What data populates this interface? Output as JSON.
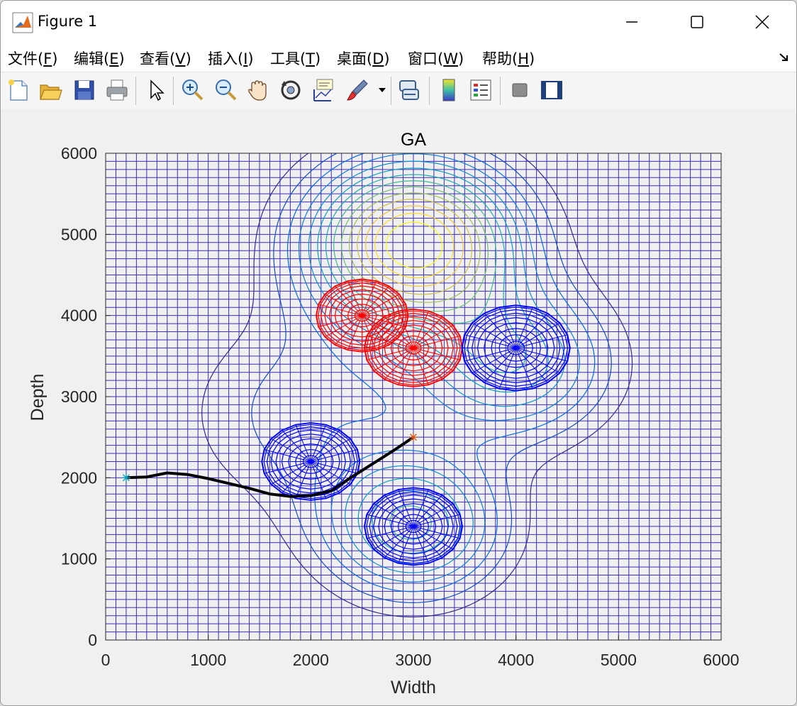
{
  "window": {
    "title": "Figure 1"
  },
  "menu": [
    {
      "label": "文件(",
      "key": "F",
      "end": ")"
    },
    {
      "label": "编辑(",
      "key": "E",
      "end": ")"
    },
    {
      "label": "查看(",
      "key": "V",
      "end": ")"
    },
    {
      "label": "插入(",
      "key": "I",
      "end": ")"
    },
    {
      "label": "工具(",
      "key": "T",
      "end": ")"
    },
    {
      "label": "桌面(",
      "key": "D",
      "end": ")"
    },
    {
      "label": "窗口(",
      "key": "W",
      "end": ")"
    },
    {
      "label": "帮助(",
      "key": "H",
      "end": ")"
    }
  ],
  "toolbar": [
    "new-figure-icon",
    "open-file-icon",
    "save-icon",
    "print-icon",
    "pointer-icon",
    "zoom-in-icon",
    "zoom-out-icon",
    "pan-icon",
    "rotate-3d-icon",
    "data-cursor-icon",
    "brush-icon",
    "link-plot-icon",
    "colorbar-icon",
    "legend-icon",
    "hide-plot-tools-icon",
    "show-plot-tools-icon"
  ],
  "chart_data": {
    "type": "line",
    "title": "GA",
    "xlabel": "Width",
    "ylabel": "Depth",
    "xlim": [
      0,
      6000
    ],
    "ylim": [
      0,
      6000
    ],
    "xticks": [
      "0",
      "1000",
      "2000",
      "3000",
      "4000",
      "5000",
      "6000"
    ],
    "yticks": [
      "0",
      "1000",
      "2000",
      "3000",
      "4000",
      "5000",
      "6000"
    ],
    "grid": true,
    "mesh_step": 100,
    "terrain_peaks": [
      {
        "x": 3000,
        "y": 4900,
        "height": 1.0,
        "spread": 700
      },
      {
        "x": 3000,
        "y": 1400,
        "height": 0.55,
        "spread": 600
      },
      {
        "x": 4000,
        "y": 3400,
        "height": 0.45,
        "spread": 650
      },
      {
        "x": 2000,
        "y": 2800,
        "height": 0.2,
        "spread": 900
      }
    ],
    "obstacles": [
      {
        "x": 2500,
        "y": 4000,
        "rx": 450,
        "ry": 450,
        "color": "#ff0000"
      },
      {
        "x": 3000,
        "y": 3600,
        "rx": 480,
        "ry": 480,
        "color": "#ff0000"
      },
      {
        "x": 4000,
        "y": 3600,
        "rx": 530,
        "ry": 530,
        "color": "#0000ff"
      },
      {
        "x": 2000,
        "y": 2200,
        "rx": 480,
        "ry": 480,
        "color": "#0000ff"
      },
      {
        "x": 3000,
        "y": 1400,
        "rx": 480,
        "ry": 480,
        "color": "#0000ff"
      }
    ],
    "path": {
      "color": "#000000",
      "x": [
        200,
        400,
        600,
        800,
        1000,
        1200,
        1400,
        1600,
        1800,
        2000,
        2200,
        2400,
        2600,
        2800,
        3000
      ],
      "y": [
        2000,
        2010,
        2060,
        2040,
        1990,
        1930,
        1870,
        1800,
        1770,
        1780,
        1840,
        2010,
        2170,
        2330,
        2500
      ]
    },
    "start": {
      "x": 200,
      "y": 2000,
      "marker": "*",
      "color": "#00a0c0"
    },
    "goal": {
      "x": 3000,
      "y": 2500,
      "marker": "*",
      "color": "#d95319"
    }
  }
}
